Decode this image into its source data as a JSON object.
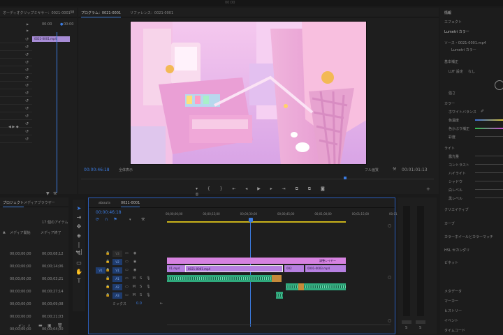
{
  "app": {
    "title": "00:00"
  },
  "source_panel": {
    "tab": "オーディオクリップミキサー：0021-0001",
    "tab_num": "38",
    "timecode_left": "00:00",
    "timecode_right": "00:00",
    "clip_label": "0021-0001.mp4"
  },
  "program": {
    "tab": "プログラム：0021-0001",
    "tab2": "リファレンス：0021-0001",
    "timecode": "00:00:46:18",
    "fit": "全体表示",
    "quality": "フル画質",
    "duration": "00:01:01:13"
  },
  "project": {
    "tab": "プロジェクト",
    "tab2": "メディアブラウザー",
    "items_count": "17 個のアイテム",
    "col1": "メディア開始",
    "col2": "メディア終了",
    "rows": [
      {
        "start": "00;00;00;00",
        "end": "00;00;08;12"
      },
      {
        "start": "00;00;00;00",
        "end": "00;00;14;06"
      },
      {
        "start": "00;00;00;00",
        "end": "00;00;03;21"
      },
      {
        "start": "00;00;00;00",
        "end": "00;00;27;14"
      },
      {
        "start": "00;00;00;00",
        "end": "00;00;09;08"
      },
      {
        "start": "00;00;00;00",
        "end": "00;00;21;03"
      },
      {
        "start": "00;00;00;00",
        "end": "00;00;04;00"
      }
    ],
    "footer": "ビン"
  },
  "timeline": {
    "tab1": "abouts",
    "tab2": "0021-0001",
    "timecode": "00:00:46:18",
    "ruler": [
      "00;00;00;00",
      "00;00;15;00",
      "00;00;30;00",
      "00;00;45;00",
      "00;01;00;00",
      "00;01;15;00",
      "00;01;30;00"
    ],
    "tracks": {
      "v3": "V3",
      "v2": "V2",
      "v1": "V1",
      "a1": "A1",
      "a2": "A2",
      "a3": "A3",
      "mix_label": "ミックス",
      "mix_value": "0.0"
    },
    "clips": {
      "adj_layer": "調整レイヤー",
      "v1a": "01.mp4",
      "v1b": "0021-0001.mp4",
      "v1c": "002",
      "v1d": "0001-0003.mp4"
    }
  },
  "meter": {
    "labels": [
      "S",
      "S"
    ]
  },
  "effects": {
    "header": "情報",
    "sub": "エフェクト",
    "lumetri": "Lumetri カラー",
    "source": "ソース・0021-0001.mp4",
    "source2": "Lumetri カラー",
    "basic": "基本補正",
    "lut": "LUT 設定",
    "lut_val": "なし",
    "intensity": "強さ",
    "color": "カラー",
    "wb": "ホワイトバランス",
    "temp": "色温度",
    "tint": "色かぶり補正",
    "sat": "彩度",
    "light": "ライト",
    "exposure": "露光量",
    "contrast": "コントラスト",
    "highlights": "ハイライト",
    "shadows": "シャドウ",
    "whites": "白レベル",
    "blacks": "黒レベル",
    "creative": "クリエイティブ",
    "curves": "カーブ",
    "wheels": "カラーホイールとカラーマッチ",
    "hsl": "HSL セカンダリ",
    "vignette": "ビネット",
    "metadata": "メタデータ",
    "markers": "マーカー",
    "history": "ヒストリー",
    "events": "イベント",
    "timecode": "タイムコード"
  }
}
